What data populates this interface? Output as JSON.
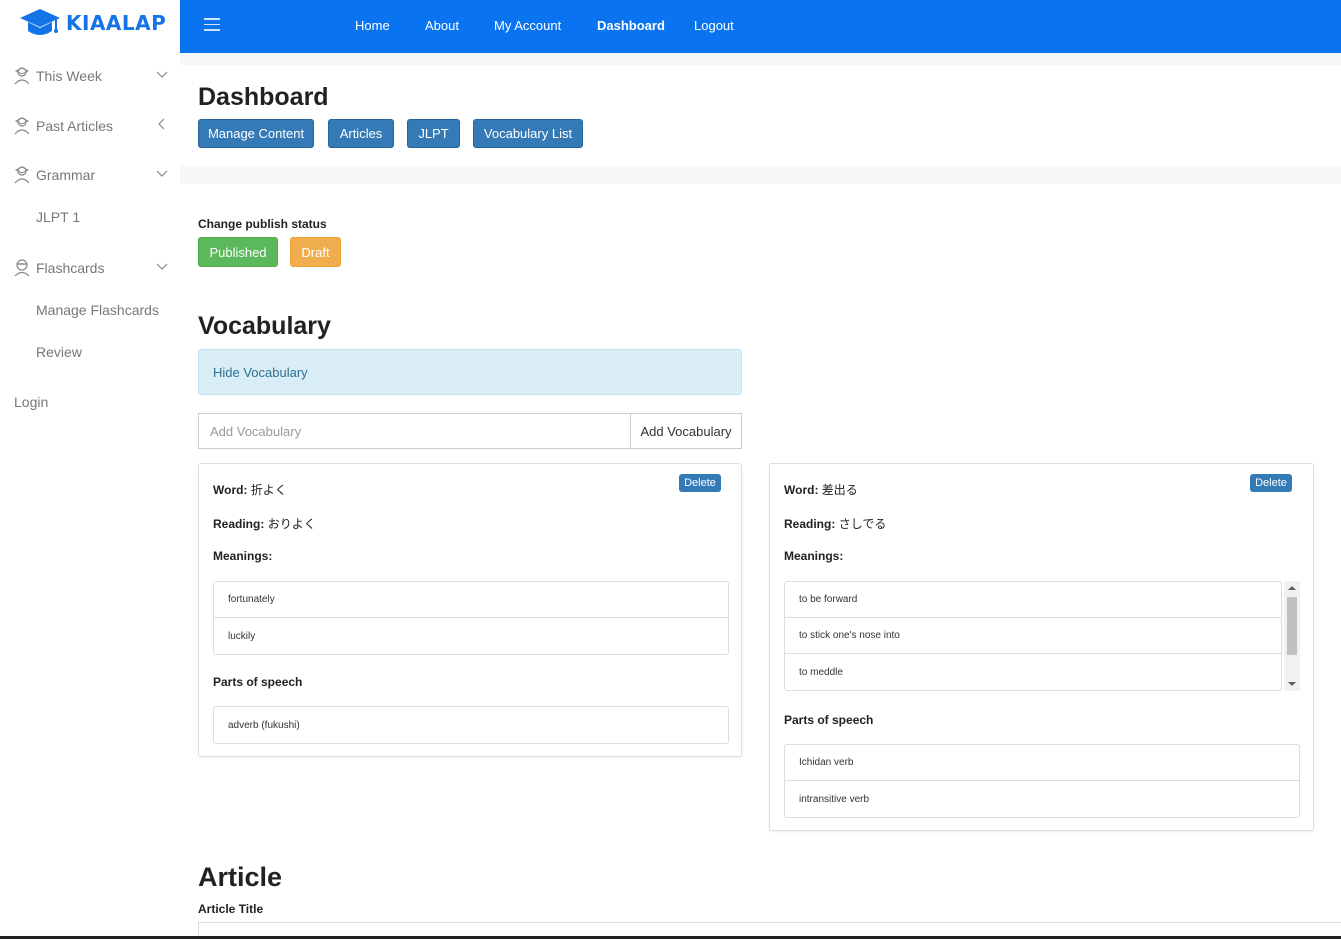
{
  "brand": {
    "name": "KIAALAP",
    "color": "#1473e6"
  },
  "sidebar": {
    "items": [
      {
        "label": "This Week",
        "icon": "student-icon",
        "chevron": "down"
      },
      {
        "label": "Past Articles",
        "icon": "student-icon",
        "chevron": "left"
      },
      {
        "label": "Grammar",
        "icon": "student-icon",
        "chevron": "down"
      },
      {
        "label": "Flashcards",
        "icon": "ninja-icon",
        "chevron": "down"
      }
    ],
    "sub_jlpt1": "JLPT 1",
    "sub_manage_flashcards": "Manage Flashcards",
    "sub_review": "Review",
    "login": "Login"
  },
  "nav": {
    "items": [
      "Home",
      "About",
      "My Account",
      "Dashboard",
      "Logout"
    ],
    "active": "Dashboard",
    "bg": "#0a74f0"
  },
  "dashboard": {
    "title": "Dashboard",
    "buttons": [
      "Manage Content",
      "Articles",
      "JLPT",
      "Vocabulary List"
    ]
  },
  "publish": {
    "label": "Change publish status",
    "published": "Published",
    "draft": "Draft",
    "published_color": "#5cb85c",
    "draft_color": "#f0ad4e"
  },
  "vocabulary": {
    "title": "Vocabulary",
    "hide_label": "Hide Vocabulary",
    "input_placeholder": "Add Vocabulary",
    "add_button": "Add Vocabulary",
    "cards": [
      {
        "word_label": "Word:",
        "word": "折よく",
        "reading_label": "Reading:",
        "reading": "おりよく",
        "meanings_label": "Meanings:",
        "meanings": [
          "fortunately",
          "luckily"
        ],
        "pos_label": "Parts of speech",
        "pos": [
          "adverb (fukushi)"
        ],
        "delete": "Delete"
      },
      {
        "word_label": "Word:",
        "word": "差出る",
        "reading_label": "Reading:",
        "reading": "さしでる",
        "meanings_label": "Meanings:",
        "meanings": [
          "to be forward",
          "to stick one's nose into",
          "to meddle"
        ],
        "pos_label": "Parts of speech",
        "pos": [
          "Ichidan verb",
          "intransitive verb"
        ],
        "delete": "Delete"
      }
    ]
  },
  "article": {
    "title": "Article",
    "title_label": "Article Title"
  }
}
